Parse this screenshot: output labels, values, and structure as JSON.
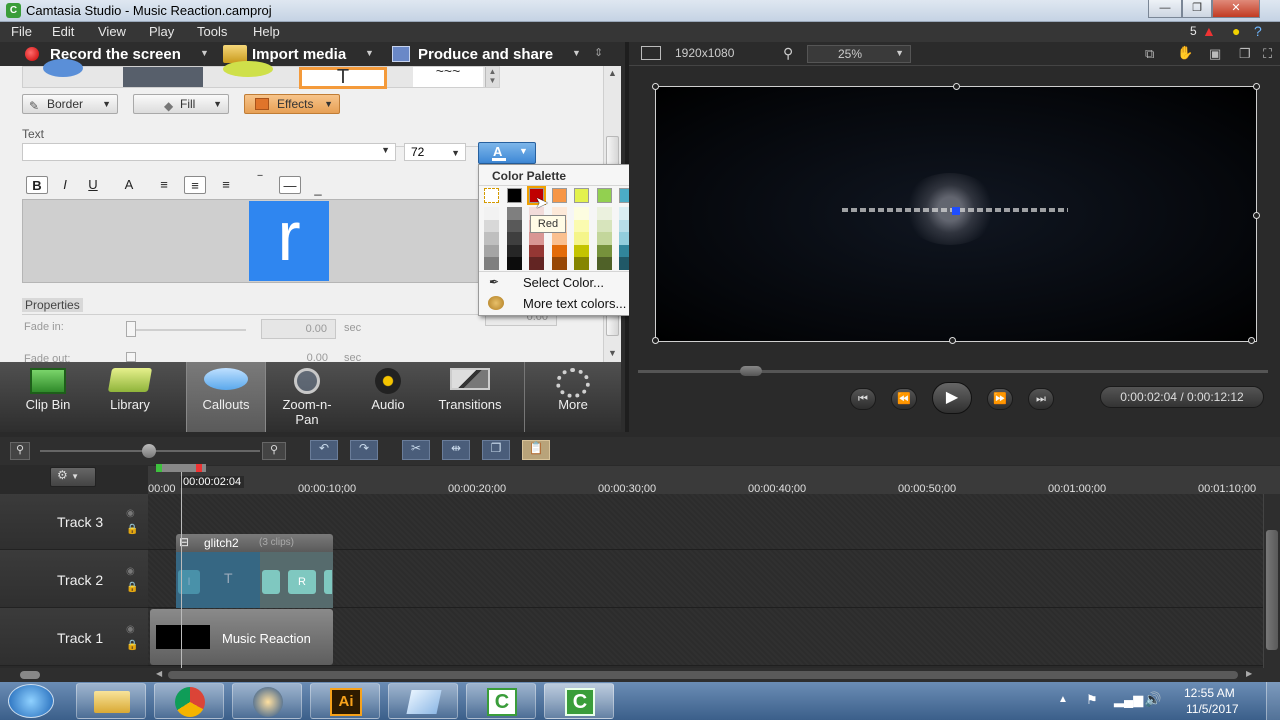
{
  "window": {
    "title": "Camtasia Studio - Music Reaction.camproj",
    "minimize": "—",
    "restore": "❐",
    "close": "✕"
  },
  "menu": {
    "items": [
      "File",
      "Edit",
      "View",
      "Play",
      "Tools",
      "Help"
    ],
    "notifications_count": "5"
  },
  "toolbar": {
    "record": "Record the screen",
    "import": "Import media",
    "produce": "Produce and share"
  },
  "editor": {
    "border_label": "Border",
    "fill_label": "Fill",
    "effects_label": "Effects",
    "text_section": "Text",
    "font_size": "72",
    "preview_letter": "r",
    "properties_label": "Properties",
    "fade_in_label": "Fade in:",
    "fade_in_value": "0.00",
    "fade_out_label": "Fade out:",
    "fade_out_value": "0.00",
    "sec_unit": "sec",
    "hidden_value": "0.00"
  },
  "palette": {
    "title": "Color Palette",
    "tooltip": "Red",
    "select_color": "Select Color...",
    "more_colors": "More text colors...",
    "top_row": [
      "#ffffff",
      "#000000",
      "#c00000",
      "#f79646",
      "#e3f24d",
      "#92d050",
      "#4bacc6",
      "#1f3864",
      "#8064a2",
      "#ff0000"
    ],
    "columns": [
      [
        "#f2f2f2",
        "#d8d8d8",
        "#bfbfbf",
        "#a5a5a5",
        "#7f7f7f"
      ],
      [
        "#7f7f7f",
        "#595959",
        "#3f3f3f",
        "#262626",
        "#0c0c0c"
      ],
      [
        "#f2dcdb",
        "#e6b9b8",
        "#d99694",
        "#953734",
        "#632523"
      ],
      [
        "#fde9d9",
        "#fbd5b5",
        "#fac08f",
        "#e36c09",
        "#974806"
      ],
      [
        "#fdfde0",
        "#fbfbb0",
        "#f5f58a",
        "#c4c400",
        "#858500"
      ],
      [
        "#ebf1de",
        "#d7e4bc",
        "#c3d69b",
        "#76923c",
        "#4f6128"
      ],
      [
        "#dbeef3",
        "#b7dde8",
        "#92cddc",
        "#31859b",
        "#205867"
      ],
      [
        "#dce6f2",
        "#b9cde5",
        "#95b3d7",
        "#366092",
        "#244061"
      ],
      [
        "#e5e0ec",
        "#ccc1d9",
        "#b2a2c7",
        "#5f497a",
        "#3f3151"
      ],
      [
        "#ffff00",
        "#00ff00",
        "#00ffff",
        "#0000ff",
        "#ff00ff"
      ]
    ]
  },
  "preview": {
    "resolution": "1920x1080",
    "zoom": "25%",
    "timecode": "0:00:02:04 / 0:00:12:12"
  },
  "tasks": [
    {
      "label": "Clip Bin",
      "icon": "film-icon"
    },
    {
      "label": "Library",
      "icon": "folder-icon"
    },
    {
      "label": "Callouts",
      "icon": "speech-bubble-icon"
    },
    {
      "label": "Zoom-n-\nPan",
      "icon": "magnifier-icon"
    },
    {
      "label": "Audio",
      "icon": "speaker-icon"
    },
    {
      "label": "Transitions",
      "icon": "transition-icon"
    },
    {
      "label": "More",
      "icon": "dots-icon"
    }
  ],
  "timeline": {
    "playhead": "00:00:02:04",
    "ticks": [
      "00:00",
      "00:00:10;00",
      "00:00:20;00",
      "00:00:30;00",
      "00:00:40;00",
      "00:00:50;00",
      "00:01:00;00",
      "00:01:10;00"
    ],
    "tracks": [
      "Track 3",
      "Track 2",
      "Track 1"
    ],
    "group_name": "glitch2",
    "group_count": "(3 clips)",
    "clip_r": "R",
    "clip_t": "T",
    "clip_i": "I",
    "audio_clip": "Music Reaction"
  },
  "taskbar": {
    "time": "12:55 AM",
    "date": "11/5/2017"
  },
  "colors": {
    "accent_red": "#d40000",
    "preview_letter_bg": "#2f86f0",
    "selection_orange": "#f49a3a"
  }
}
